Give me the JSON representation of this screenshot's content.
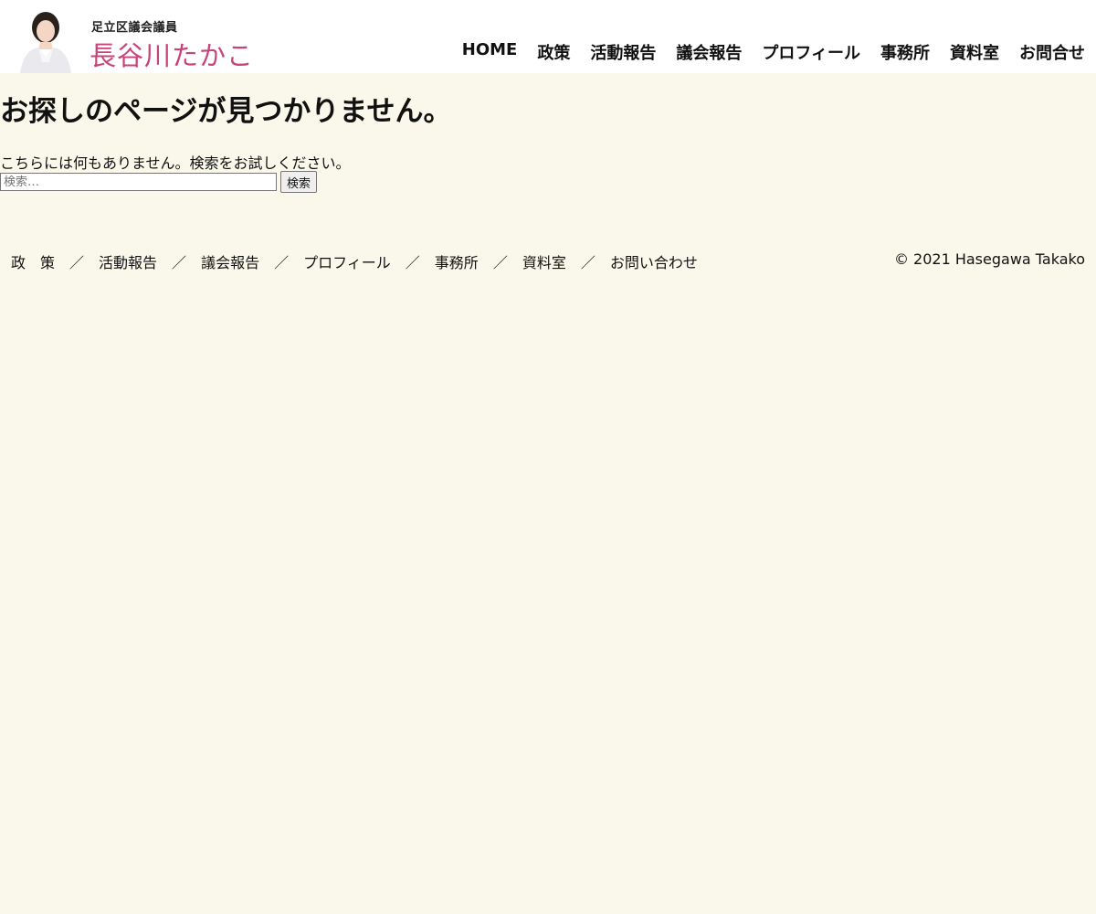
{
  "header": {
    "logo_sub": "足立区議会議員",
    "logo_name": "長谷川たかこ",
    "brand_color": "#c7447a",
    "nav": [
      {
        "label": "HOME"
      },
      {
        "label": "政策"
      },
      {
        "label": "活動報告"
      },
      {
        "label": "議会報告"
      },
      {
        "label": "プロフィール"
      },
      {
        "label": "事務所"
      },
      {
        "label": "資料室"
      },
      {
        "label": "お問合せ"
      }
    ]
  },
  "main": {
    "title": "お探しのページが見つかりません。",
    "message": "こちらには何もありません。検索をお試しください。",
    "search": {
      "placeholder": "検索…",
      "value": "",
      "button_label": "検索"
    }
  },
  "footer": {
    "nav": [
      {
        "label": "政　策"
      },
      {
        "label": "活動報告"
      },
      {
        "label": "議会報告"
      },
      {
        "label": "プロフィール"
      },
      {
        "label": "事務所"
      },
      {
        "label": "資料室"
      },
      {
        "label": "お問い合わせ"
      }
    ],
    "separator": "／",
    "copyright": "© 2021 Hasegawa Takako"
  },
  "colors": {
    "background": "#faf8ea",
    "header_background": "#ffffff"
  }
}
